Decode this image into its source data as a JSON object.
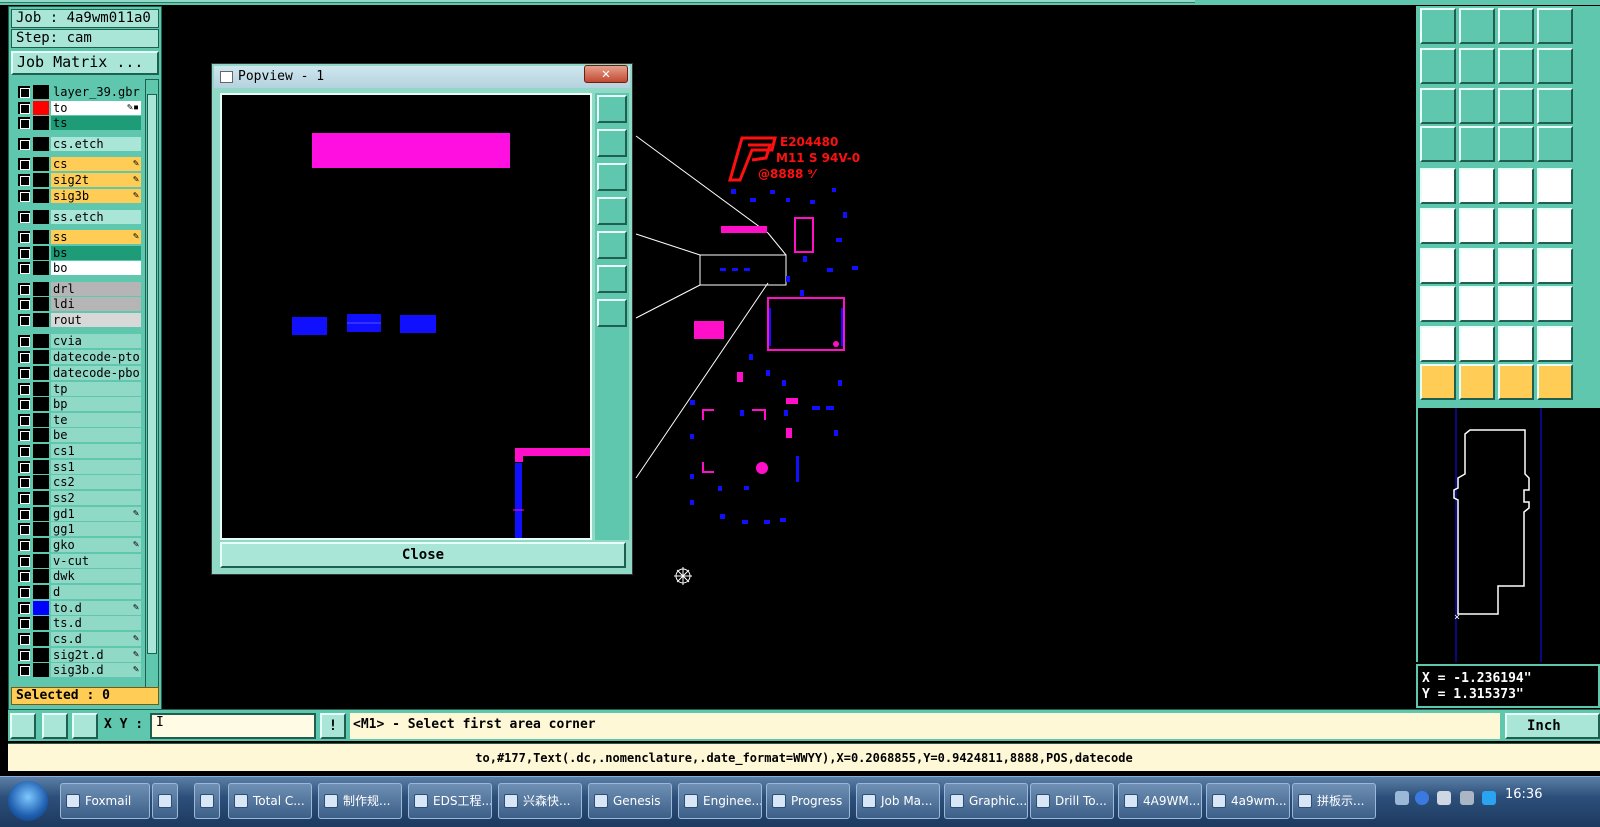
{
  "left_panel": {
    "job": "Job : 4a9wm011a0",
    "step": "Step: cam",
    "job_matrix_button": "Job Matrix ...",
    "selected": "Selected : 0",
    "layers": [
      {
        "name": "layer_39.gbr",
        "color": "#000000",
        "bg": "#5ec7ad",
        "edit": ""
      },
      {
        "name": "to",
        "color": "#ff0000",
        "bg": "#ffffff",
        "edit": "✎▪"
      },
      {
        "name": "ts",
        "color": "#000000",
        "bg": "#1e9c78",
        "edit": ""
      },
      {
        "name": "cs.etch",
        "color": "#000000",
        "bg": "#a9e6d7",
        "edit": ""
      },
      {
        "name": "cs",
        "color": "#000000",
        "bg": "#ffcc55",
        "edit": "✎"
      },
      {
        "name": "sig2t",
        "color": "#000000",
        "bg": "#ffcc55",
        "edit": "✎"
      },
      {
        "name": "sig3b",
        "color": "#000000",
        "bg": "#ffcc55",
        "edit": "✎"
      },
      {
        "name": "ss.etch",
        "color": "#000000",
        "bg": "#a9e6d7",
        "edit": ""
      },
      {
        "name": "ss",
        "color": "#000000",
        "bg": "#ffcc55",
        "edit": "✎"
      },
      {
        "name": "bs",
        "color": "#000000",
        "bg": "#1e9c78",
        "edit": ""
      },
      {
        "name": "bo",
        "color": "#000000",
        "bg": "#ffffff",
        "edit": ""
      },
      {
        "name": "drl",
        "color": "#000000",
        "bg": "#b5b5b5",
        "edit": ""
      },
      {
        "name": "ldi",
        "color": "#000000",
        "bg": "#b5b5b5",
        "edit": ""
      },
      {
        "name": "rout",
        "color": "#000000",
        "bg": "#d8d8d8",
        "edit": ""
      },
      {
        "name": "cvia",
        "color": "#000000",
        "bg": "#8fd9c6",
        "edit": ""
      },
      {
        "name": "datecode-pto",
        "color": "#000000",
        "bg": "#8fd9c6",
        "edit": ""
      },
      {
        "name": "datecode-pbo",
        "color": "#000000",
        "bg": "#8fd9c6",
        "edit": ""
      },
      {
        "name": "tp",
        "color": "#000000",
        "bg": "#8fd9c6",
        "edit": ""
      },
      {
        "name": "bp",
        "color": "#000000",
        "bg": "#8fd9c6",
        "edit": ""
      },
      {
        "name": "te",
        "color": "#000000",
        "bg": "#8fd9c6",
        "edit": ""
      },
      {
        "name": "be",
        "color": "#000000",
        "bg": "#8fd9c6",
        "edit": ""
      },
      {
        "name": "cs1",
        "color": "#000000",
        "bg": "#8fd9c6",
        "edit": ""
      },
      {
        "name": "ss1",
        "color": "#000000",
        "bg": "#8fd9c6",
        "edit": ""
      },
      {
        "name": "cs2",
        "color": "#000000",
        "bg": "#8fd9c6",
        "edit": ""
      },
      {
        "name": "ss2",
        "color": "#000000",
        "bg": "#8fd9c6",
        "edit": ""
      },
      {
        "name": "gd1",
        "color": "#000000",
        "bg": "#8fd9c6",
        "edit": "✎"
      },
      {
        "name": "gg1",
        "color": "#000000",
        "bg": "#8fd9c6",
        "edit": ""
      },
      {
        "name": "gko",
        "color": "#000000",
        "bg": "#8fd9c6",
        "edit": "✎"
      },
      {
        "name": "v-cut",
        "color": "#000000",
        "bg": "#8fd9c6",
        "edit": ""
      },
      {
        "name": "dwk",
        "color": "#000000",
        "bg": "#8fd9c6",
        "edit": ""
      },
      {
        "name": "d",
        "color": "#000000",
        "bg": "#8fd9c6",
        "edit": ""
      },
      {
        "name": "to.d",
        "color": "#0000ff",
        "bg": "#8fd9c6",
        "edit": "✎"
      },
      {
        "name": "ts.d",
        "color": "#000000",
        "bg": "#8fd9c6",
        "edit": ""
      },
      {
        "name": "cs.d",
        "color": "#000000",
        "bg": "#8fd9c6",
        "edit": "✎"
      },
      {
        "name": "sig2t.d",
        "color": "#000000",
        "bg": "#8fd9c6",
        "edit": "✎"
      },
      {
        "name": "sig3b.d",
        "color": "#000000",
        "bg": "#8fd9c6",
        "edit": "✎"
      }
    ]
  },
  "popview": {
    "title": "Popview - 1",
    "close_x": "✕",
    "close_button": "Close"
  },
  "canvas": {
    "silk_text_1": "E204480",
    "silk_text_2": "M11 S 94V-0",
    "silk_text_3": "@8888 ⁹⁄"
  },
  "coords": {
    "x": "X = -1.236194\"",
    "y": "Y = 1.315373\""
  },
  "command_bar": {
    "xy_label": "X Y :",
    "xy_value": "I",
    "bang": "!",
    "prompt": "<M1> - Select first area corner",
    "unit": "Inch"
  },
  "info_bar": {
    "text": "to,#177,Text(.dc,.nomenclature,.date_format=WWYY),X=0.2068855,Y=0.9424811,8888,POS,datecode"
  },
  "taskbar": {
    "items": [
      "Foxmail",
      "",
      "",
      "Total C...",
      "制作规...",
      "EDS工程...",
      "兴森快...",
      "Genesis",
      "Enginee...",
      "Progress",
      "Job Ma...",
      "Graphic...",
      "Drill To...",
      "4A9WM...",
      "4a9wm...",
      "拼板示..."
    ],
    "clock": "16:36"
  },
  "colors": {
    "panel": "#5ec7ad",
    "magenta": "#ff00ff",
    "blue": "#0000ff",
    "red": "#ff0000"
  }
}
